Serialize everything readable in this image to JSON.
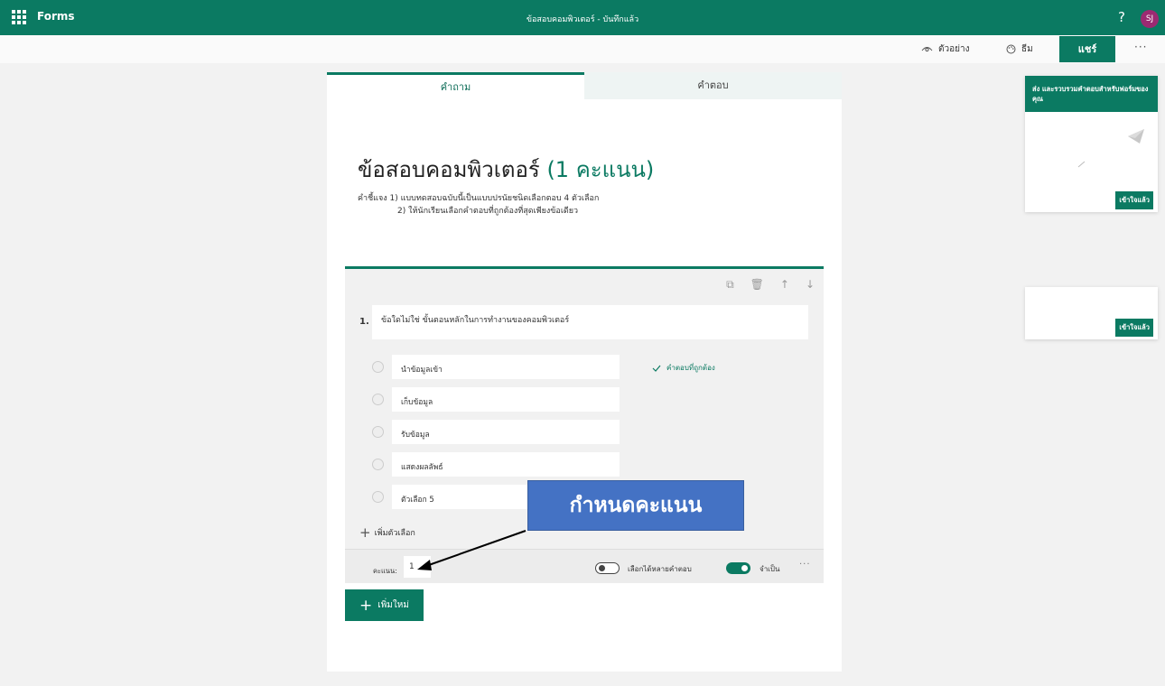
{
  "topbar": {
    "app_name": "Forms",
    "doc_title": "ข้อสอบคอมพิวเตอร์ - บันทึกแล้ว",
    "help": "?",
    "avatar_initials": "SJ"
  },
  "commandbar": {
    "preview_label": "ตัวอย่าง",
    "theme_label": "ธีม",
    "share_label": "แชร์",
    "more_label": "···"
  },
  "tabs": {
    "questions": "คำถาม",
    "responses": "คำตอบ"
  },
  "form": {
    "title": "ข้อสอบคอมพิวเตอร์",
    "points": "(1 คะแนน)",
    "desc_line1": "คำชี้แจง   1)  แบบทดสอบฉบับนี้เป็นแบบปรนัยชนิดเลือกตอบ 4  ตัวเลือก",
    "desc_line2": "2)  ให้นักเรียนเลือกคำตอบที่ถูกต้องที่สุดเพียงข้อเดียว"
  },
  "question": {
    "number": "1.",
    "text": "ข้อใดไม่ใช่ ขั้นตอนหลักในการทำงานของคอมพิวเตอร์",
    "options": [
      "นำข้อมูลเข้า",
      "เก็บข้อมูล",
      "รับข้อมูล",
      "แสดงผลลัพธ์",
      "ตัวเลือก 5"
    ],
    "correct_label": "คำตอบที่ถูกต้อง",
    "add_option_label": "เพิ่มตัวเลือก",
    "score_label": "คะแนน:",
    "score_value": "1",
    "multi_answer_label": "เลือกได้หลายคำตอบ",
    "required_label": "จำเป็น",
    "more_label": "···"
  },
  "add_new_label": "เพิ่มใหม่",
  "callout_text": "กำหนดคะแนน",
  "share_panel": {
    "heading": "ส่ง และรวบรวมคำตอบสำหรับฟอร์มของคุณ",
    "got_it": "เข้าใจแล้ว"
  },
  "share_panel2": {
    "got_it": "เข้าใจแล้ว"
  },
  "colors": {
    "brand": "#0b7a62",
    "callout": "#4472c4",
    "avatar": "#9c2a72"
  }
}
